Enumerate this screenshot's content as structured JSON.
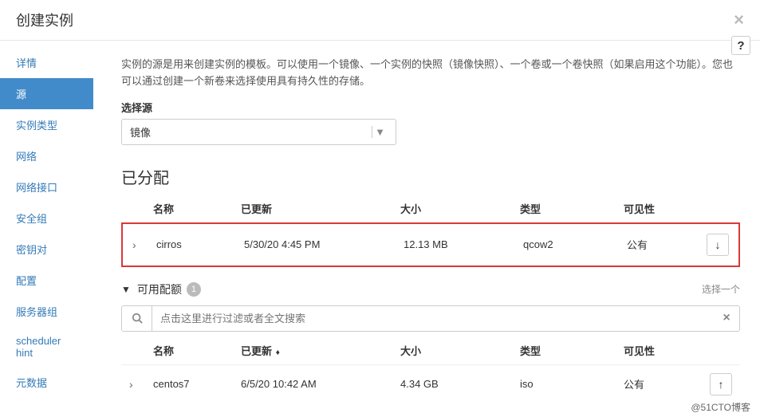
{
  "modal": {
    "title": "创建实例"
  },
  "sidebar": {
    "items": [
      {
        "label": "详情"
      },
      {
        "label": "源"
      },
      {
        "label": "实例类型"
      },
      {
        "label": "网络"
      },
      {
        "label": "网络接口"
      },
      {
        "label": "安全组"
      },
      {
        "label": "密钥对"
      },
      {
        "label": "配置"
      },
      {
        "label": "服务器组"
      },
      {
        "label": "scheduler hint"
      },
      {
        "label": "元数据"
      }
    ],
    "activeIndex": 1
  },
  "main": {
    "description": "实例的源是用来创建实例的模板。可以使用一个镜像、一个实例的快照（镜像快照）、一个卷或一个卷快照（如果启用这个功能）。您也可以通过创建一个新卷来选择使用具有持久性的存储。",
    "selectSourceLabel": "选择源",
    "selectSourceValue": "镜像",
    "allocated": {
      "title": "已分配",
      "headers": {
        "name": "名称",
        "updated": "已更新",
        "size": "大小",
        "type": "类型",
        "visibility": "可见性"
      },
      "rows": [
        {
          "name": "cirros",
          "updated": "5/30/20 4:45 PM",
          "size": "12.13 MB",
          "type": "qcow2",
          "visibility": "公有"
        }
      ]
    },
    "available": {
      "title": "可用配额",
      "count": "1",
      "selectOneText": "选择一个",
      "searchPlaceholder": "点击这里进行过滤或者全文搜索",
      "headers": {
        "name": "名称",
        "updated": "已更新",
        "size": "大小",
        "type": "类型",
        "visibility": "可见性"
      },
      "rows": [
        {
          "name": "centos7",
          "updated": "6/5/20 10:42 AM",
          "size": "4.34 GB",
          "type": "iso",
          "visibility": "公有"
        }
      ]
    }
  },
  "footer": {
    "credit": "@51CTO博客"
  }
}
